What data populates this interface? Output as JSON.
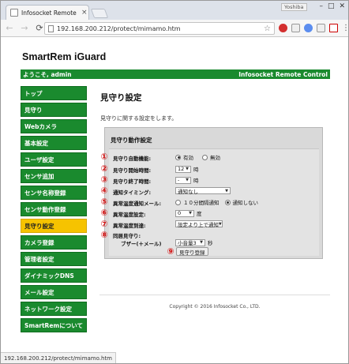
{
  "browser": {
    "tab_title": "Infosocket Remote Co",
    "tab_close": "×",
    "user_label": "Yoshiba",
    "window_controls": [
      "–",
      "□",
      "✕"
    ],
    "url": "192.168.200.212/protect/mimamo.htm",
    "status_url": "192.168.200.212/protect/mimamo.htm",
    "back": "←",
    "forward": "→",
    "reload": "⟳",
    "star": "☆",
    "menu": "⋮"
  },
  "app": {
    "title": "SmartRem iGuard",
    "welcome": "ようこそ, admin",
    "brand": "Infosocket Remote Control",
    "accent": "#1a8a2e",
    "active_color": "#f6c300"
  },
  "sidebar": {
    "items": [
      {
        "label": "トップ"
      },
      {
        "label": "見守り"
      },
      {
        "label": "Webカメラ"
      },
      {
        "label": "基本設定"
      },
      {
        "label": "ユーザ設定"
      },
      {
        "label": "センサ追加"
      },
      {
        "label": "センサ名称登録"
      },
      {
        "label": "センサ動作登録"
      },
      {
        "label": "見守り設定"
      },
      {
        "label": "カメラ登録"
      },
      {
        "label": "管理者設定"
      },
      {
        "label": "ダイナミックDNS"
      },
      {
        "label": "メール設定"
      },
      {
        "label": "ネットワーク設定"
      },
      {
        "label": "SmartRemについて"
      }
    ],
    "active_index": 8
  },
  "main": {
    "title": "見守り設定",
    "description": "見守りに関する設定をします。"
  },
  "settings": {
    "title": "見守り動作設定",
    "rows": [
      {
        "num": "①",
        "label": "見守り自動機能:",
        "opt1": "有効",
        "opt2": "無効"
      },
      {
        "num": "②",
        "label": "見守り開始時間:",
        "value": "12",
        "unit": "時"
      },
      {
        "num": "③",
        "label": "見守り終了時間:",
        "value": "-",
        "unit": "時"
      },
      {
        "num": "④",
        "label": "通知タイミング:",
        "value": "通知なし"
      },
      {
        "num": "⑤",
        "label": "異常温度通知メール:",
        "opt1": "１０分間隔通知",
        "opt2": "通知しない"
      },
      {
        "num": "⑥",
        "label": "異常温度設定:",
        "value": "0",
        "unit": "度"
      },
      {
        "num": "⑦",
        "label": "異常温度到達:",
        "value": "設定より上で通知"
      },
      {
        "num": "⑧",
        "label": "同居見守り:",
        "sublabel": "ブザー(＋メール)",
        "value": "小音量3",
        "unit": "秒"
      }
    ],
    "submit_num": "⑨",
    "submit_label": "見守り登録"
  },
  "footer": {
    "copyright": "Copyright © 2016 Infosocket Co., LTD."
  }
}
